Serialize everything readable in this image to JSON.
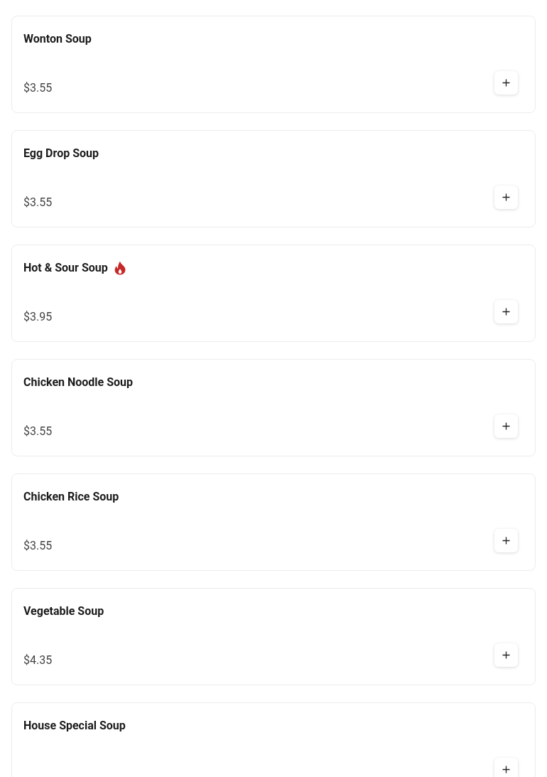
{
  "items": [
    {
      "name": "Wonton Soup",
      "spicy": false,
      "price": "$3.55"
    },
    {
      "name": "Egg Drop Soup",
      "spicy": false,
      "price": "$3.55"
    },
    {
      "name": "Hot & Sour Soup",
      "spicy": true,
      "price": "$3.95"
    },
    {
      "name": "Chicken Noodle Soup",
      "spicy": false,
      "price": "$3.55"
    },
    {
      "name": "Chicken Rice Soup",
      "spicy": false,
      "price": "$3.55"
    },
    {
      "name": "Vegetable Soup",
      "spicy": false,
      "price": "$4.35"
    },
    {
      "name": "House Special Soup",
      "spicy": false
    }
  ]
}
